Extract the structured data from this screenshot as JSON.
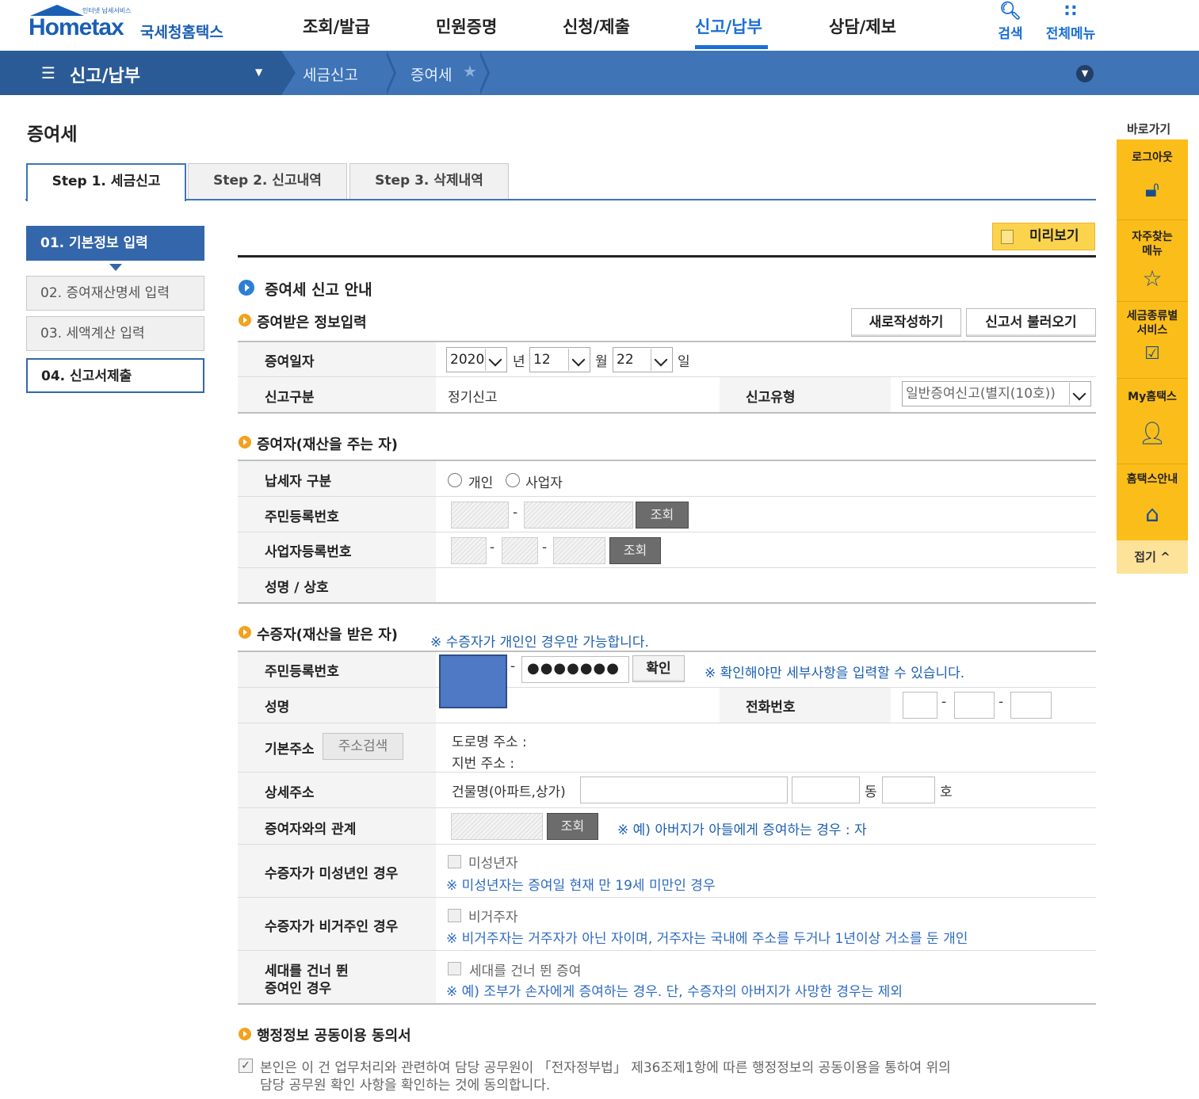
{
  "header": {
    "logo_small": "인터넷 납세서비스",
    "logo_brand": "Hometax",
    "logo_kr": "국세청홈택스",
    "nav": [
      "조회/발급",
      "민원증명",
      "신청/제출",
      "신고/납부",
      "상담/제보"
    ],
    "active_nav": "신고/납부",
    "search_label": "검색",
    "allmenu_label": "전체메뉴"
  },
  "bar": {
    "menu_title": "신고/납부",
    "crumb1": "세금신고",
    "crumb2": "증여세"
  },
  "page_title": "증여세",
  "tabs": [
    "Step 1. 세금신고",
    "Step 2. 신고내역",
    "Step 3. 삭제내역"
  ],
  "left_steps": [
    "01. 기본정보 입력",
    "02. 증여재산명세 입력",
    "03. 세액계산 입력",
    "04. 신고서제출"
  ],
  "preview_label": "미리보기",
  "guide_title": "증여세 신고 안내",
  "sec_received": {
    "title": "증여받은 정보입력",
    "btn_new": "새로작성하기",
    "btn_load": "신고서 불러오기",
    "date_label": "증여일자",
    "year": "2020",
    "year_unit": "년",
    "month": "12",
    "month_unit": "월",
    "day": "22",
    "day_unit": "일",
    "report_kind_label": "신고구분",
    "report_kind_value": "정기신고",
    "report_type_label": "신고유형",
    "report_type_value": "일반증여신고(별지(10호))"
  },
  "sec_donor": {
    "title": "증여자(재산을 주는 자)",
    "taxpayer_label": "납세자 구분",
    "opt_individual": "개인",
    "opt_business": "사업자",
    "rrn_label": "주민등록번호",
    "brn_label": "사업자등록번호",
    "name_label": "성명 / 상호",
    "lookup": "조회",
    "dash": "-"
  },
  "sec_donee": {
    "title": "수증자(재산을 받은 자)",
    "title_note": "※ 수증자가 개인인 경우만 가능합니다.",
    "rrn_label": "주민등록번호",
    "rrn_masked": "●●●●●●●",
    "confirm": "확인",
    "confirm_note": "※ 확인해야만 세부사항을 입력할 수 있습니다.",
    "name_label": "성명",
    "phone_label": "전화번호",
    "addr_label": "기본주소",
    "addr_search": "주소검색",
    "road_addr": "도로명 주소 :",
    "jibun_addr": "지번 주소 :",
    "detail_label": "상세주소",
    "building_label": "건물명(아파트,상가)",
    "dong": "동",
    "ho": "호",
    "relation_label": "증여자와의 관계",
    "relation_lookup": "조회",
    "relation_note": "※ 예) 아버지가 아들에게 증여하는 경우 : 자",
    "minor_label": "수증자가 미성년인 경우",
    "minor_chk": "미성년자",
    "minor_note": "※ 미성년자는 증여일 현재 만 19세 미만인 경우",
    "nonres_label": "수증자가 비거주인 경우",
    "nonres_chk": "비거주자",
    "nonres_note": "※ 비거주자는 거주자가 아닌 자이며, 거주자는 국내에 주소를 두거나 1년이상 거소를 둔 개인",
    "skip_label_1": "세대를 건너 뛴",
    "skip_label_2": "증여인 경우",
    "skip_chk": "세대를 건너 뛴 증여",
    "skip_note": "※ 예) 조부가 손자에게 증여하는 경우. 단, 수증자의 아버지가 사망한 경우는 제외"
  },
  "sec_agree": {
    "title": "행정정보 공동이용 동의서",
    "text_1": "본인은 이 건 업무처리와 관련하여 담당 공무원이 「전자정부법」 제36조제1항에 따른 행정정보의 공동이용을 통하여 위의",
    "text_2": "담당 공무원 확인 사항을 확인하는 것에 동의합니다."
  },
  "quickbar": {
    "title": "바로가기",
    "items": [
      "로그아웃",
      "자주찾는 메뉴",
      "세금종류별 서비스",
      "My홈택스",
      "홈택스안내"
    ],
    "fold": "접기 ^"
  }
}
